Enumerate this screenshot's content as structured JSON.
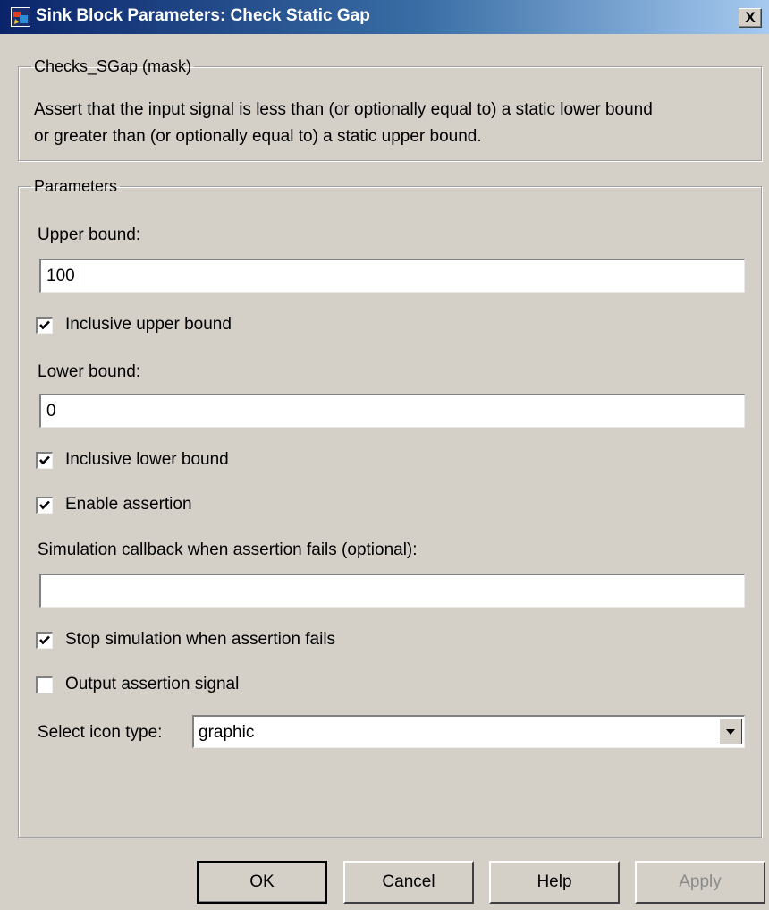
{
  "window": {
    "title": "Sink Block Parameters: Check Static Gap",
    "close_label": "X"
  },
  "mask_group": {
    "legend": "Checks_SGap (mask)",
    "description_line1": "Assert that the input signal is less than (or optionally equal to) a static lower bound",
    "description_line2": "or greater than (or optionally equal to) a static upper bound."
  },
  "parameters": {
    "legend": "Parameters",
    "upper_bound_label": "Upper bound:",
    "upper_bound_value": "100",
    "inclusive_upper_label": "Inclusive upper bound",
    "inclusive_upper_checked": true,
    "lower_bound_label": "Lower bound:",
    "lower_bound_value": "0",
    "inclusive_lower_label": "Inclusive lower bound",
    "inclusive_lower_checked": true,
    "enable_assertion_label": "Enable assertion",
    "enable_assertion_checked": true,
    "callback_label": "Simulation callback when assertion fails (optional):",
    "callback_value": "",
    "stop_simulation_label": "Stop simulation when assertion fails",
    "stop_simulation_checked": true,
    "output_signal_label": "Output assertion signal",
    "output_signal_checked": false,
    "icon_type_label": "Select icon type:",
    "icon_type_value": "graphic"
  },
  "buttons": {
    "ok": "OK",
    "cancel": "Cancel",
    "help": "Help",
    "apply": "Apply"
  },
  "colors": {
    "title_gradient_start": "#0a246a",
    "title_gradient_end": "#a6caf0",
    "dialog_face": "#d4d0c8"
  }
}
